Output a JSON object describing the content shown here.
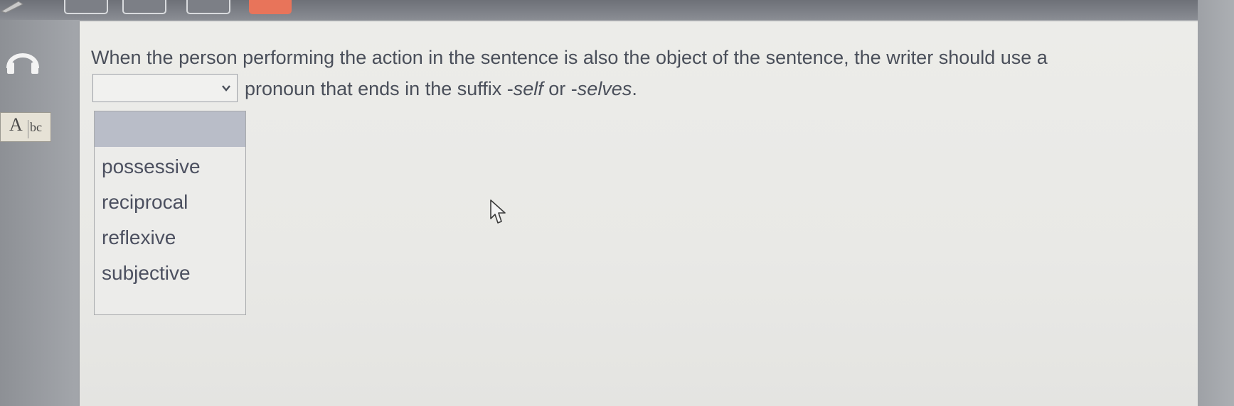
{
  "question": {
    "line1": "When the person performing the action in the sentence is also the object of the sentence, the writer should use a",
    "line2_prefix": "pronoun that ends in the suffix -",
    "suffix_self": "self",
    "line2_mid": " or -",
    "suffix_selves": "selves",
    "line2_end": "."
  },
  "select": {
    "value": "",
    "options": [
      "possessive",
      "reciprocal",
      "reflexive",
      "subjective"
    ]
  },
  "icons": {
    "headphones": "headphones-icon",
    "abc": "abc-tool-icon",
    "abc_big": "A",
    "abc_small": "bc",
    "arrow": "chevron-down-icon",
    "cursor": "mouse-cursor-icon",
    "pencil": "pencil-icon"
  },
  "colors": {
    "option_text": "#4c5060",
    "question_text": "#4a4f5a",
    "dropdown_header": "#b9bdc8",
    "accent_tab": "#e8745a"
  }
}
